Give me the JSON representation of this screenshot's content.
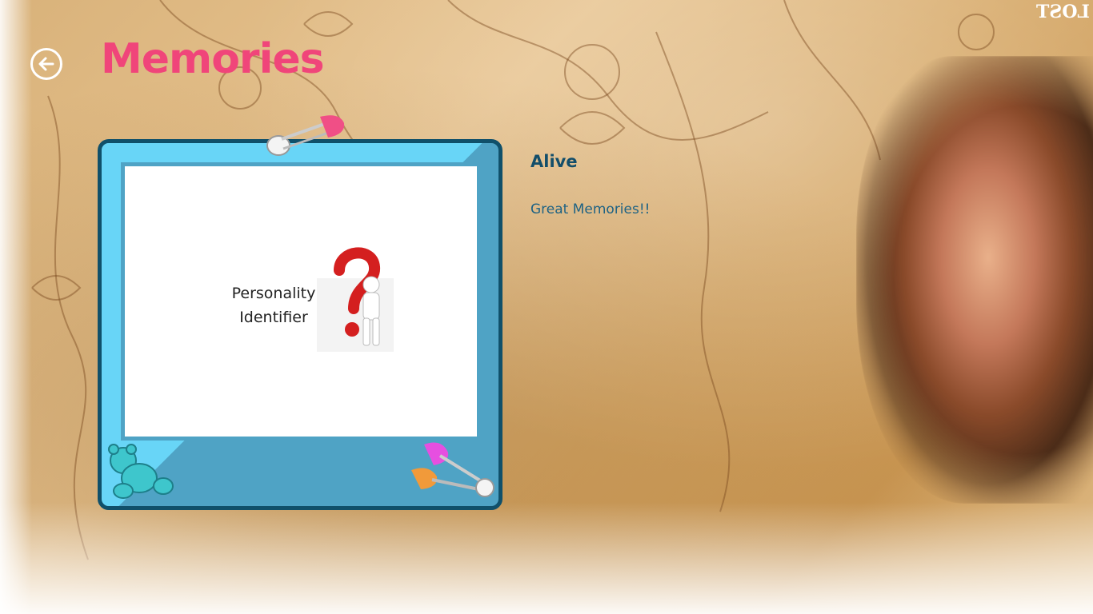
{
  "header": {
    "title": "Memories",
    "back_icon": "back-arrow-icon",
    "watermark": "LOST"
  },
  "item": {
    "title": "Alive",
    "description": "Great Memories!!",
    "image_caption": "Personality Identifier"
  },
  "colors": {
    "title": "#f0457a",
    "frame_dark": "#10506a",
    "frame_light": "#68d5f7",
    "frame_mid": "#4fa3c5",
    "item_title": "#134e6a",
    "item_text": "#1f6384"
  }
}
